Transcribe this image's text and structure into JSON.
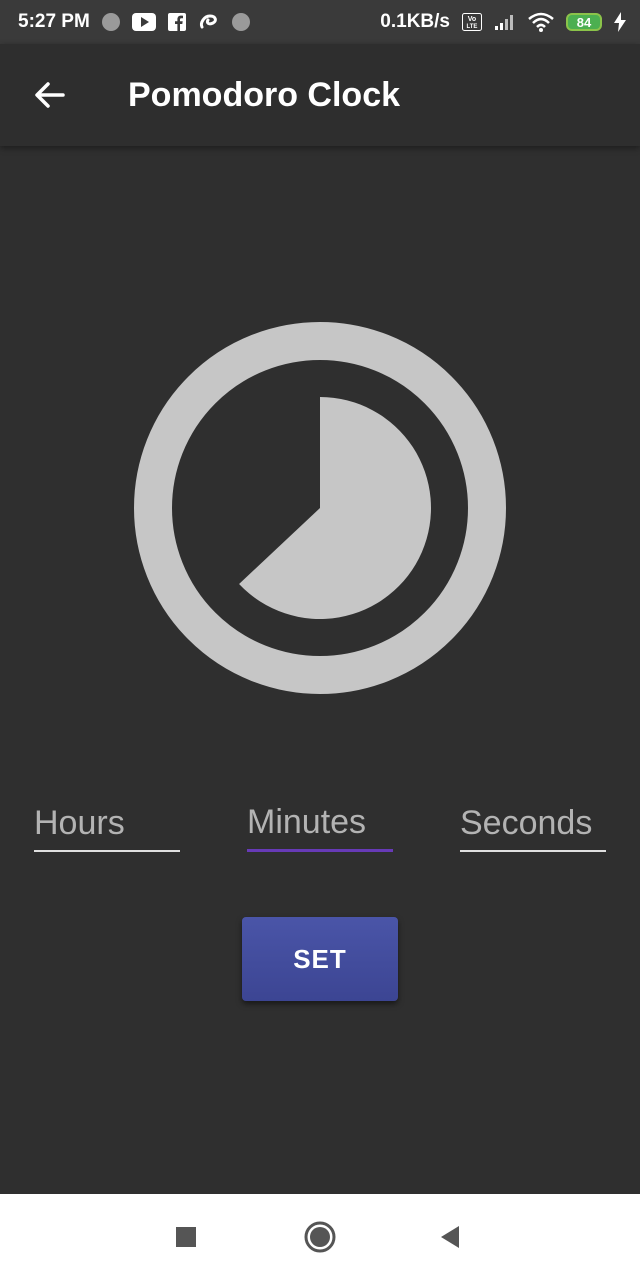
{
  "status_bar": {
    "time": "5:27 PM",
    "net_speed": "0.1KB/s",
    "volte": "Vo LTE",
    "battery": "84",
    "left_icons": [
      "circle-icon",
      "youtube-icon",
      "facebook-icon",
      "airtel-icon",
      "circle-icon"
    ],
    "right_icons": [
      "volte-icon",
      "signal-icon",
      "wifi-icon",
      "battery-icon",
      "charging-icon"
    ]
  },
  "app_bar": {
    "title": "Pomodoro Clock",
    "back_icon": "arrow-left-icon"
  },
  "timer": {
    "remaining_fraction": 0.63,
    "colors": {
      "ring": "#c6c6c6",
      "background": "#2f2f2f"
    }
  },
  "fields": {
    "hours": {
      "placeholder": "Hours",
      "value": ""
    },
    "minutes": {
      "placeholder": "Minutes",
      "value": ""
    },
    "seconds": {
      "placeholder": "Seconds",
      "value": ""
    },
    "active_accent": "#673ab7"
  },
  "set_button": {
    "label": "SET",
    "color": "#3f4a9e"
  },
  "nav_bar": {
    "icons": [
      "recents-square-icon",
      "home-circle-icon",
      "back-triangle-icon"
    ]
  }
}
